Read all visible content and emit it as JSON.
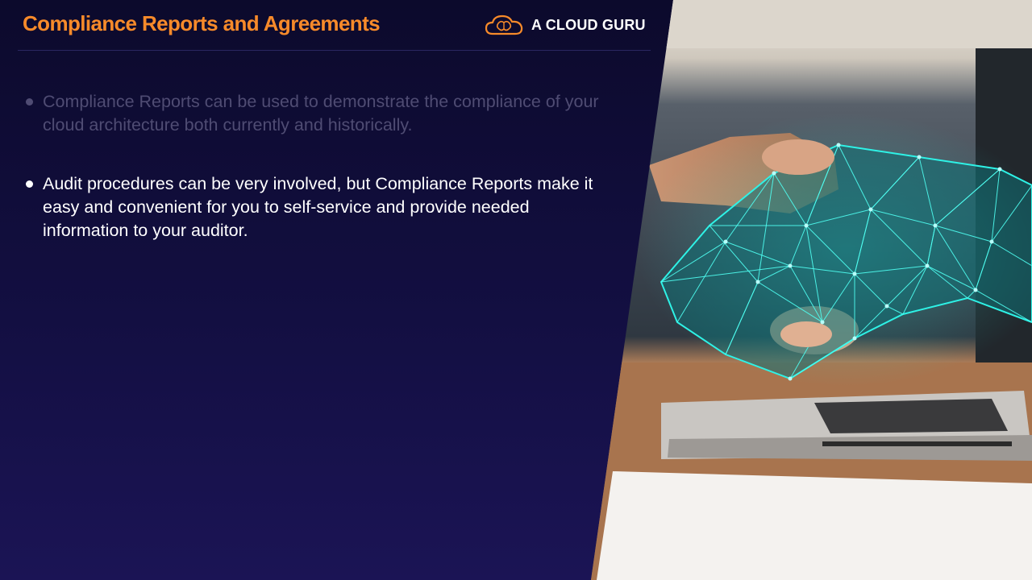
{
  "slide": {
    "title": "Compliance Reports and Agreements",
    "logo": {
      "icon": "cloud-brain-icon",
      "text": "A CLOUD GURU"
    },
    "bullets": [
      {
        "text": "Compliance Reports can be used to demonstrate the compliance of your cloud architecture both currently and historically.",
        "state": "dimmed"
      },
      {
        "text": "Audit procedures can be very involved, but Compliance Reports make it easy and convenient for you to self-service and provide needed information to your auditor.",
        "state": "active"
      }
    ],
    "image": {
      "subject": "handshake-with-digital-hand-over-laptop"
    }
  },
  "colors": {
    "title": "#f78a2a",
    "background": "#130f42",
    "active_text": "#ffffff",
    "dimmed_text": "#4f4c73",
    "digital_hand": "#2ef2e6"
  }
}
